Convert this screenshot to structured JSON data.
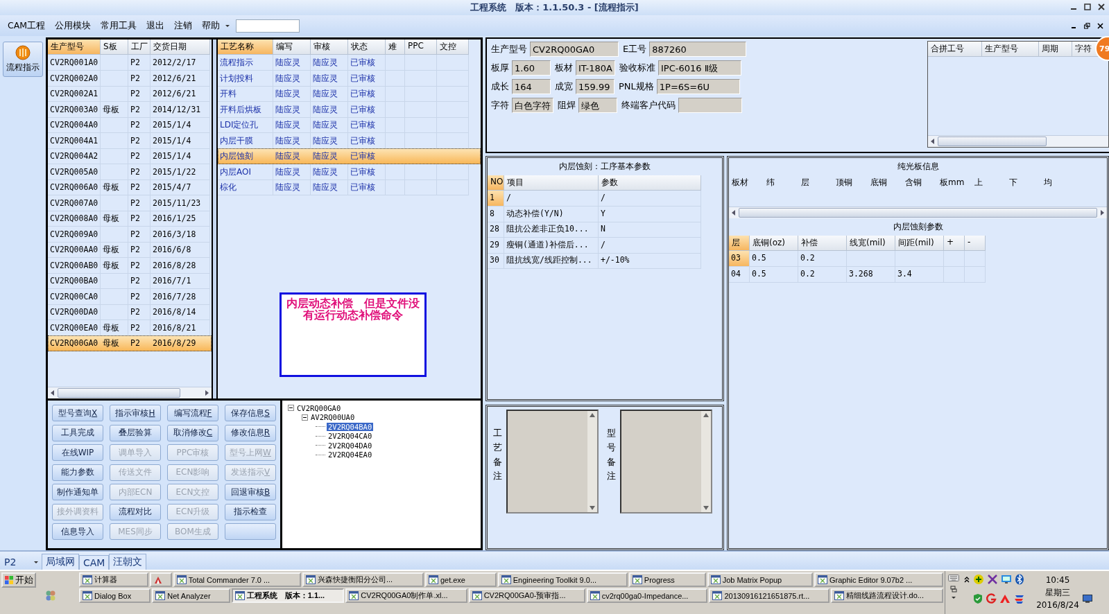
{
  "window": {
    "title": "工程系统　版本：1.1.50.3 - [流程指示]"
  },
  "menu": {
    "items": [
      "CAM工程",
      "公用模块",
      "常用工具",
      "退出",
      "注销",
      "帮助"
    ]
  },
  "nav": [
    {
      "label": "流程指示",
      "selected": true
    }
  ],
  "models": {
    "columns": [
      {
        "label": "生产型号",
        "sorted": true
      },
      {
        "label": "S板",
        "sorted": false
      },
      {
        "label": "工厂",
        "sorted": false
      },
      {
        "label": "交货日期",
        "sorted": false
      }
    ],
    "rows": [
      {
        "cells": [
          "CV2RQ001A0",
          "",
          "P2",
          "2012/2/17"
        ],
        "selected": false
      },
      {
        "cells": [
          "CV2RQ002A0",
          "",
          "P2",
          "2012/6/21"
        ],
        "selected": false
      },
      {
        "cells": [
          "CV2RQ002A1",
          "",
          "P2",
          "2012/6/21"
        ],
        "selected": false
      },
      {
        "cells": [
          "CV2RQ003A0",
          "母板",
          "P2",
          "2014/12/31"
        ],
        "selected": false
      },
      {
        "cells": [
          "CV2RQ004A0",
          "",
          "P2",
          "2015/1/4"
        ],
        "selected": false
      },
      {
        "cells": [
          "CV2RQ004A1",
          "",
          "P2",
          "2015/1/4"
        ],
        "selected": false
      },
      {
        "cells": [
          "CV2RQ004A2",
          "",
          "P2",
          "2015/1/4"
        ],
        "selected": false
      },
      {
        "cells": [
          "CV2RQ005A0",
          "",
          "P2",
          "2015/1/22"
        ],
        "selected": false
      },
      {
        "cells": [
          "CV2RQ006A0",
          "母板",
          "P2",
          "2015/4/7"
        ],
        "selected": false
      },
      {
        "cells": [
          "CV2RQ007A0",
          "",
          "P2",
          "2015/11/23"
        ],
        "selected": false
      },
      {
        "cells": [
          "CV2RQ008A0",
          "母板",
          "P2",
          "2016/1/25"
        ],
        "selected": false
      },
      {
        "cells": [
          "CV2RQ009A0",
          "",
          "P2",
          "2016/3/18"
        ],
        "selected": false
      },
      {
        "cells": [
          "CV2RQ00AA0",
          "母板",
          "P2",
          "2016/6/8"
        ],
        "selected": false
      },
      {
        "cells": [
          "CV2RQ00AB0",
          "母板",
          "P2",
          "2016/8/28"
        ],
        "selected": false
      },
      {
        "cells": [
          "CV2RQ00BA0",
          "",
          "P2",
          "2016/7/1"
        ],
        "selected": false
      },
      {
        "cells": [
          "CV2RQ00CA0",
          "",
          "P2",
          "2016/7/28"
        ],
        "selected": false
      },
      {
        "cells": [
          "CV2RQ00DA0",
          "",
          "P2",
          "2016/8/14"
        ],
        "selected": false
      },
      {
        "cells": [
          "CV2RQ00EA0",
          "母板",
          "P2",
          "2016/8/21"
        ],
        "selected": false
      },
      {
        "cells": [
          "CV2RQ00GA0",
          "母板",
          "P2",
          "2016/8/29"
        ],
        "selected": true
      }
    ]
  },
  "process": {
    "columns": [
      {
        "label": "工艺名称",
        "sorted": true
      },
      {
        "label": "编写",
        "sorted": false
      },
      {
        "label": "审核",
        "sorted": false
      },
      {
        "label": "状态",
        "sorted": false
      },
      {
        "label": "难",
        "sorted": false
      },
      {
        "label": "PPC",
        "sorted": false
      },
      {
        "label": "文控",
        "sorted": false
      }
    ],
    "rows": [
      {
        "cells": [
          "流程指示",
          "陆应灵",
          "陆应灵",
          "已审核"
        ],
        "selected": false
      },
      {
        "cells": [
          "计划投料",
          "陆应灵",
          "陆应灵",
          "已审核"
        ],
        "selected": false
      },
      {
        "cells": [
          "开料",
          "陆应灵",
          "陆应灵",
          "已审核"
        ],
        "selected": false
      },
      {
        "cells": [
          "开料后烘板",
          "陆应灵",
          "陆应灵",
          "已审核"
        ],
        "selected": false
      },
      {
        "cells": [
          "LDI定位孔",
          "陆应灵",
          "陆应灵",
          "已审核"
        ],
        "selected": false
      },
      {
        "cells": [
          "内层干膜",
          "陆应灵",
          "陆应灵",
          "已审核"
        ],
        "selected": false
      },
      {
        "cells": [
          "内层蚀刻",
          "陆应灵",
          "陆应灵",
          "已审核"
        ],
        "selected": true
      },
      {
        "cells": [
          "内层AOI",
          "陆应灵",
          "陆应灵",
          "已审核"
        ],
        "selected": false
      },
      {
        "cells": [
          "棕化",
          "陆应灵",
          "陆应灵",
          "已审核"
        ],
        "selected": false
      }
    ]
  },
  "note": "内层动态补偿　但是文件没有运行动态补偿命令",
  "buttons": [
    {
      "label": "型号查询",
      "shortcut": "X",
      "disabled": false
    },
    {
      "label": "指示审核",
      "shortcut": "H",
      "disabled": false
    },
    {
      "label": "编写流程",
      "shortcut": "F",
      "disabled": false
    },
    {
      "label": "保存信息",
      "shortcut": "S",
      "disabled": false
    },
    {
      "label": "工具完成",
      "disabled": false
    },
    {
      "label": "叠层验算",
      "disabled": false
    },
    {
      "label": "取消修改",
      "shortcut": "C",
      "disabled": false
    },
    {
      "label": "修改信息",
      "shortcut": "R",
      "disabled": false
    },
    {
      "label": "在线WIP",
      "disabled": false
    },
    {
      "label": "调单导入",
      "disabled": true
    },
    {
      "label": "PPC审核",
      "disabled": true
    },
    {
      "label": "型号上网",
      "shortcut": "W",
      "disabled": true
    },
    {
      "label": "能力参数",
      "disabled": false
    },
    {
      "label": "传送文件",
      "disabled": true
    },
    {
      "label": "ECN影响",
      "disabled": true
    },
    {
      "label": "发送指示",
      "shortcut": "V",
      "disabled": true
    },
    {
      "label": "制作通知单",
      "disabled": false
    },
    {
      "label": "内部ECN",
      "disabled": true
    },
    {
      "label": "ECN文控",
      "disabled": true
    },
    {
      "label": "回退审核",
      "shortcut": "B",
      "disabled": false
    },
    {
      "label": "接外调资料",
      "disabled": true
    },
    {
      "label": "流程对比",
      "disabled": false
    },
    {
      "label": "ECN升级",
      "disabled": true
    },
    {
      "label": "指示检查",
      "disabled": false
    },
    {
      "label": "信息导入",
      "disabled": false
    },
    {
      "label": "MES同步",
      "disabled": true
    },
    {
      "label": "BOM生成",
      "disabled": true
    },
    {
      "disabled": false
    }
  ],
  "tree": [
    {
      "label": "CV2RQ00GA0",
      "expanded": true,
      "selected": false,
      "children": [
        {
          "label": "AV2RQ00UA0",
          "expanded": true,
          "selected": false,
          "children": [
            {
              "label": "2V2RQ04BA0",
              "selected": true
            },
            {
              "label": "2V2RQ04CA0",
              "selected": false
            },
            {
              "label": "2V2RQ04DA0",
              "selected": false
            },
            {
              "label": "2V2RQ04EA0",
              "selected": false
            }
          ]
        }
      ]
    }
  ],
  "info": [
    [
      {
        "label": "生产型号",
        "value": "CV2RQ00GA0"
      },
      {
        "label": "E工号",
        "value": "887260"
      }
    ],
    [
      {
        "label": "板厚",
        "value": "1.60"
      },
      {
        "label": "板材",
        "value": "IT-180A"
      },
      {
        "label": "验收标准",
        "value": "IPC-6016 Ⅱ级"
      }
    ],
    [
      {
        "label": "成长",
        "value": "164"
      },
      {
        "label": "成宽",
        "value": "159.99"
      },
      {
        "label": "PNL规格",
        "value": "1P=6S=6U"
      }
    ],
    [
      {
        "label": "字符",
        "value": "白色字符"
      },
      {
        "label": "阻焊",
        "value": "绿色"
      },
      {
        "label": "终端客户代码"
      }
    ]
  ],
  "merge": {
    "columns": [
      "合拼工号",
      "生产型号",
      "周期",
      "字符"
    ]
  },
  "badge": "79",
  "params": {
    "title": "内层蚀刻：工序基本参数",
    "columns": [
      "NO",
      "项目",
      "参数"
    ],
    "rows": [
      {
        "cells": [
          "1",
          "/",
          "/"
        ],
        "current": true
      },
      {
        "cells": [
          "8",
          "动态补偿(Y/N)",
          "Y"
        ],
        "current": false
      },
      {
        "cells": [
          "28",
          "阻抗公差非正负10...",
          "N"
        ],
        "current": false
      },
      {
        "cells": [
          "29",
          "瘦铜(通道)补偿后...",
          "/"
        ],
        "current": false
      },
      {
        "cells": [
          "30",
          "阻抗线宽/线距控制...",
          "+/-10%"
        ],
        "current": false
      }
    ]
  },
  "board": {
    "title": "纯光板信息",
    "columns": [
      "板材",
      "纬",
      "层",
      "顶铜",
      "底铜",
      "含铜",
      "板mm",
      "上",
      "下",
      "均"
    ]
  },
  "etch": {
    "title": "内层蚀刻参数",
    "columns": [
      "层",
      "底铜(oz)",
      "补偿",
      "线宽(mil)",
      "间距(mil)",
      "+",
      "-"
    ],
    "rows": [
      {
        "cells": [
          "03",
          "0.5",
          "0.2",
          "",
          "",
          "",
          ""
        ],
        "current": true
      },
      {
        "cells": [
          "04",
          "0.5",
          "0.2",
          "3.268",
          "3.4",
          "",
          ""
        ],
        "current": false
      }
    ]
  },
  "remarks": [
    "工艺备注",
    "型号备注"
  ],
  "status": {
    "factory": "P2",
    "tabs": [
      "局域网",
      "CAM",
      "汪朝文"
    ]
  },
  "taskbar": {
    "start": "开始",
    "upper_tasks": [
      {
        "kind": "label",
        "label": "计算器",
        "active": false
      },
      {
        "kind": "icon",
        "active": false
      },
      {
        "kind": "label",
        "label": "Total Commander 7.0 ...",
        "active": false
      },
      {
        "kind": "label",
        "label": "兴森快捷衡阳分公司...",
        "active": false
      },
      {
        "kind": "label",
        "label": "get.exe",
        "active": false
      },
      {
        "kind": "label",
        "label": "Engineering Toolkit 9.0...",
        "active": false
      },
      {
        "kind": "label",
        "label": "Progress",
        "active": false
      },
      {
        "kind": "label",
        "label": "Job Matrix Popup",
        "active": false
      },
      {
        "kind": "label",
        "label": "Graphic Editor 9.07b2 ...",
        "active": false
      }
    ],
    "lower_tasks": [
      {
        "kind": "label",
        "label": "Dialog Box",
        "active": false
      },
      {
        "kind": "label",
        "label": "Net Analyzer",
        "active": false
      },
      {
        "kind": "label",
        "label": "工程系统　版本：1.1...",
        "active": true
      },
      {
        "kind": "label",
        "label": "CV2RQ00GA0制作单.xl...",
        "active": false
      },
      {
        "kind": "label",
        "label": "CV2RQ00GA0-预审指...",
        "active": false
      },
      {
        "kind": "label",
        "label": "cv2rq00ga0-Impedance...",
        "active": false
      },
      {
        "kind": "label",
        "label": "20130916121651875.rt...",
        "active": false
      },
      {
        "kind": "label",
        "label": "精细线路流程设计.do...",
        "active": false
      }
    ],
    "clock": [
      "10:45",
      "星期三",
      "2016/8/24"
    ]
  }
}
